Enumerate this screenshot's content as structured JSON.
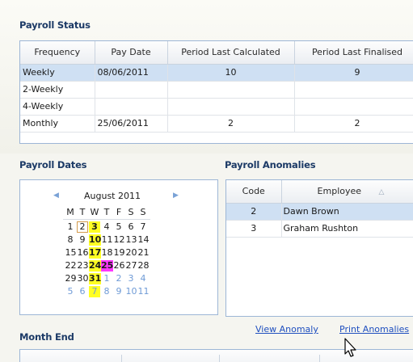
{
  "payroll_status": {
    "title": "Payroll Status",
    "columns": [
      "Frequency",
      "Pay Date",
      "Period Last Calculated",
      "Period Last Finalised"
    ],
    "rows": [
      {
        "frequency": "Weekly",
        "pay_date": "08/06/2011",
        "last_calc": "10",
        "last_final": "9"
      },
      {
        "frequency": "2-Weekly",
        "pay_date": "",
        "last_calc": "",
        "last_final": ""
      },
      {
        "frequency": "4-Weekly",
        "pay_date": "",
        "last_calc": "",
        "last_final": ""
      },
      {
        "frequency": "Monthly",
        "pay_date": "25/06/2011",
        "last_calc": "2",
        "last_final": "2"
      }
    ]
  },
  "payroll_dates": {
    "title": "Payroll Dates",
    "month_label": "August 2011",
    "prev_arrow": "◀",
    "next_arrow": "▶",
    "days_of_week": [
      "M",
      "T",
      "W",
      "T",
      "F",
      "S",
      "S"
    ],
    "weeks": [
      [
        "",
        "1",
        "2",
        "3",
        "4",
        "5",
        "6",
        "7"
      ],
      [
        "",
        "8",
        "9",
        "10",
        "11",
        "12",
        "13",
        "14"
      ],
      [
        "",
        "15",
        "16",
        "17",
        "18",
        "19",
        "20",
        "21"
      ],
      [
        "",
        "22",
        "23",
        "24",
        "25",
        "26",
        "27",
        "28"
      ],
      [
        "",
        "29",
        "30",
        "31",
        "1",
        "2",
        "3",
        "4"
      ],
      [
        "",
        "5",
        "6",
        "7",
        "8",
        "9",
        "10",
        "11"
      ]
    ]
  },
  "payroll_anomalies": {
    "title": "Payroll Anomalies",
    "columns": [
      "Code",
      "Employee"
    ],
    "sort_glyph": "△",
    "rows": [
      {
        "code": "2",
        "employee": "Dawn Brown"
      },
      {
        "code": "3",
        "employee": "Graham Rushton"
      }
    ],
    "view_link": "View Anomaly",
    "print_link": "Print Anomalies"
  },
  "month_end": {
    "title": "Month End"
  },
  "colors": {
    "yellow_highlight": "#ffff24",
    "magenta_highlight": "#ff36ff",
    "selected_row": "#cfe0f3",
    "section_title": "#1c3a66"
  }
}
